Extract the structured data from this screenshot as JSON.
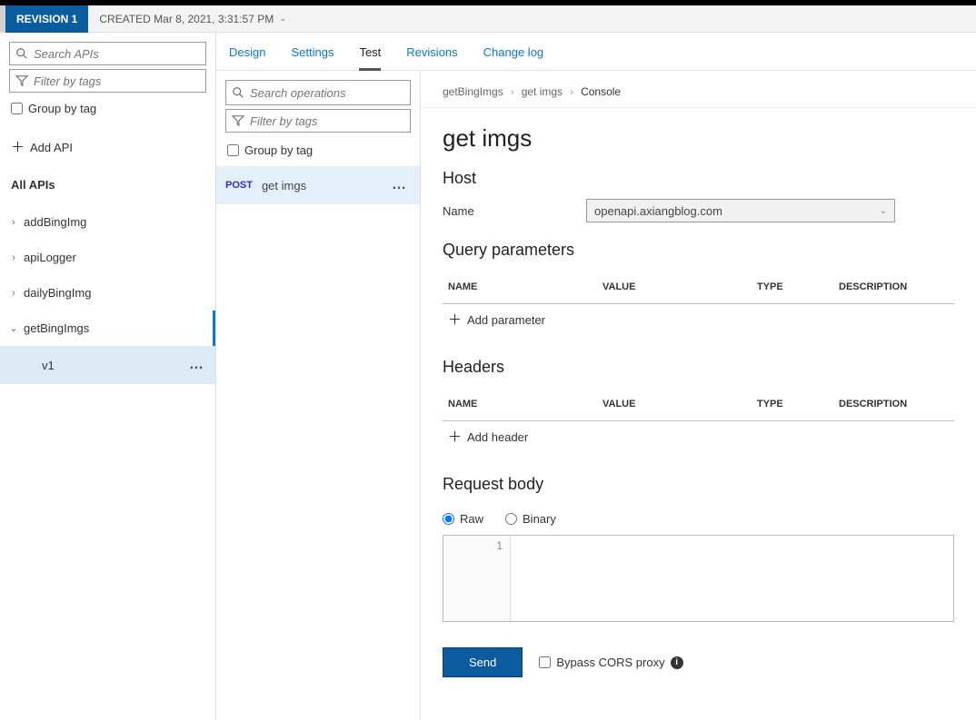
{
  "revision": {
    "badge": "REVISION 1",
    "meta": "CREATED Mar 8, 2021, 3:31:57 PM"
  },
  "sidebar": {
    "search_placeholder": "Search APIs",
    "filter_placeholder": "Filter by tags",
    "group_by_tag": "Group by tag",
    "add_api": "Add API",
    "all_apis": "All APIs",
    "apis": [
      {
        "label": "addBingImg",
        "expanded": false
      },
      {
        "label": "apiLogger",
        "expanded": false
      },
      {
        "label": "dailyBingImg",
        "expanded": false
      },
      {
        "label": "getBingImgs",
        "expanded": true,
        "sub": "v1"
      }
    ]
  },
  "tabs_top": [
    {
      "label": "Design"
    },
    {
      "label": "Settings"
    },
    {
      "label": "Test",
      "active": true
    },
    {
      "label": "Revisions"
    },
    {
      "label": "Change log"
    }
  ],
  "operations": {
    "search_placeholder": "Search operations",
    "filter_placeholder": "Filter by tags",
    "group_by_tag": "Group by tag",
    "items": [
      {
        "verb": "POST",
        "name": "get imgs"
      }
    ]
  },
  "console": {
    "breadcrumb": [
      "getBingImgs",
      "get imgs",
      "Console"
    ],
    "title": "get imgs",
    "host_section": "Host",
    "host_name_label": "Name",
    "host_value": "openapi.axiangblog.com",
    "query_section": "Query parameters",
    "headers_section": "Headers",
    "body_section": "Request body",
    "table_headers": {
      "name": "NAME",
      "value": "VALUE",
      "type": "TYPE",
      "description": "DESCRIPTION"
    },
    "add_parameter": "Add parameter",
    "add_header": "Add header",
    "body_radio": {
      "raw": "Raw",
      "binary": "Binary"
    },
    "editor_line": "1",
    "send": "Send",
    "bypass": "Bypass CORS proxy"
  }
}
